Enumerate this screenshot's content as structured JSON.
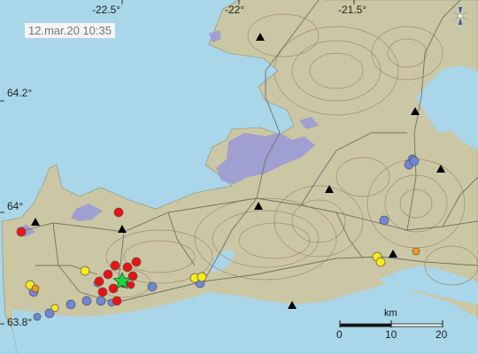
{
  "timestamp": "12.mar.20  10:35",
  "lon_labels": [
    "-22.5°",
    "-22°",
    "-21.5°"
  ],
  "lat_labels": [
    "64.2°",
    "64°",
    "63.8°"
  ],
  "scale": {
    "unit": "km",
    "ticks": [
      "0",
      "10",
      "20"
    ]
  },
  "colors": {
    "sea": "#a9d6e9",
    "land": "#cbc7a4",
    "lava": "#9f9fd1",
    "contour": "#a48b6c",
    "road": "#7a7a78",
    "red": "#ee1111",
    "orange": "#f39a11",
    "yellow": "#f7ea1b",
    "blue": "#6e87d6",
    "star": "#22d34a"
  },
  "icon": "compass-logo-icon"
}
